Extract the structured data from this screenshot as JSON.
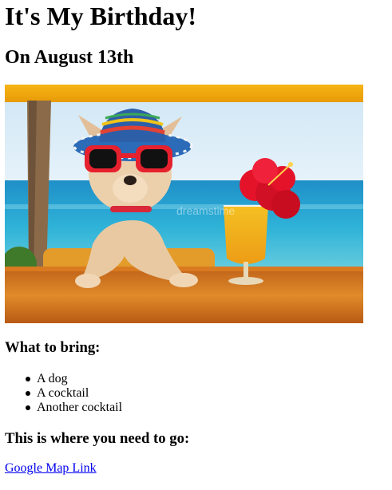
{
  "page": {
    "title": "It's My Birthday!",
    "subtitle": "On August 13th"
  },
  "photo": {
    "description_icon": "dog-with-sombrero-and-cocktail-photo",
    "watermark": "dreamstime"
  },
  "bring": {
    "heading": "What to bring:",
    "items": [
      "A dog",
      "A cocktail",
      "Another cocktail"
    ]
  },
  "location": {
    "heading": "This is where you need to go:",
    "link_text": "Google Map Link"
  },
  "colors": {
    "link": "#0000ee",
    "text": "#000000"
  }
}
